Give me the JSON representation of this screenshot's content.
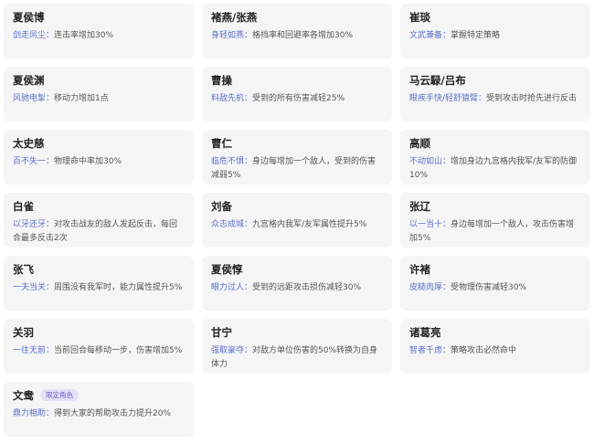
{
  "accent_color": "#5b6fc8",
  "tag_color": "#6b63c9",
  "cards": [
    {
      "name": "夏侯博",
      "skill": "剑走风尘：",
      "effect": "连击率增加30%",
      "tag": ""
    },
    {
      "name": "褚燕/张燕",
      "skill": "身轻如燕：",
      "effect": "格挡率和回避率各增加30%",
      "tag": ""
    },
    {
      "name": "崔琰",
      "skill": "文武兼备：",
      "effect": "掌握特定策略",
      "tag": ""
    },
    {
      "name": "夏侯渊",
      "skill": "风驰电掣：",
      "effect": "移动力增加1点",
      "tag": ""
    },
    {
      "name": "曹操",
      "skill": "料敌先机：",
      "effect": "受到的所有伤害减轻25%",
      "tag": ""
    },
    {
      "name": "马云騄/吕布",
      "skill": "眼疾手快/轻舒猿臂：",
      "effect": "受到攻击时抢先进行反击",
      "tag": ""
    },
    {
      "name": "太史慈",
      "skill": "百不失一：",
      "effect": "物理命中率加30%",
      "tag": ""
    },
    {
      "name": "曹仁",
      "skill": "临危不惧：",
      "effect": "身边每增加一个敌人，受到的伤害减弱5%",
      "tag": ""
    },
    {
      "name": "高顺",
      "skill": "不动如山：",
      "effect": "增加身边九宫格内我军/友军的防御10%",
      "tag": ""
    },
    {
      "name": "白雀",
      "skill": "以牙还牙：",
      "effect": "对攻击战友的敌人发起反击，每回合最多反击2次",
      "tag": ""
    },
    {
      "name": "刘备",
      "skill": "众志成城：",
      "effect": "九宫格内我军/友军属性提升5%",
      "tag": ""
    },
    {
      "name": "张辽",
      "skill": "以一当十：",
      "effect": "身边每增加一个敌人，攻击伤害增加5%",
      "tag": ""
    },
    {
      "name": "张飞",
      "skill": "一夫当关：",
      "effect": "周围没有我军时，能力属性提升5%",
      "tag": ""
    },
    {
      "name": "夏侯惇",
      "skill": "眼力过人：",
      "effect": "受到的远距攻击损伤减轻30%",
      "tag": ""
    },
    {
      "name": "许褚",
      "skill": "皮糙肉厚：",
      "effect": "受物理伤害减轻30%",
      "tag": ""
    },
    {
      "name": "关羽",
      "skill": "一往无前：",
      "effect": "当前回合每移动一步，伤害增加5%",
      "tag": ""
    },
    {
      "name": "甘宁",
      "skill": "强取豪夺：",
      "effect": "对敌方单位伤害的50%转换为自身体力",
      "tag": ""
    },
    {
      "name": "诸葛亮",
      "skill": "智者千虑：",
      "effect": "策略攻击必然命中",
      "tag": ""
    },
    {
      "name": "文鸯",
      "skill": "鼎力相助：",
      "effect": "得到大家的帮助攻击力提升20%",
      "tag": "限定角色"
    }
  ]
}
